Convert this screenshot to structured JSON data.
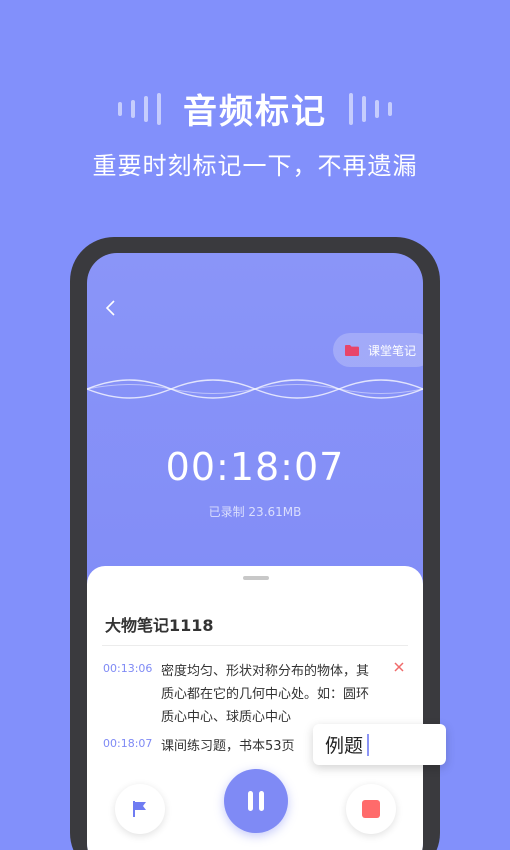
{
  "headline": {
    "title": "音频标记",
    "subtitle": "重要时刻标记一下，不再遗漏"
  },
  "recorder": {
    "folder_label": "课堂笔记",
    "elapsed": "00:18:07",
    "size_text": "已录制 23.61MB"
  },
  "sheet": {
    "title": "大物笔记1118",
    "marks": [
      {
        "time": "00:13:06",
        "text": "密度均匀、形状对称分布的物体，其质心都在它的几何中心处。如：圆环质心中心、球质心中心"
      },
      {
        "time": "00:18:07",
        "text": "课间练习题，书本53页"
      }
    ]
  },
  "tooltip": {
    "text": "例题"
  },
  "icons": [
    "chevron-left-icon",
    "folder-icon",
    "close-icon",
    "flag-icon",
    "pause-icon",
    "stop-icon"
  ],
  "colors": {
    "background": "#8290fb",
    "accent": "#7f8af5",
    "stop": "#ff6b6b",
    "folder": "#e8456a"
  }
}
